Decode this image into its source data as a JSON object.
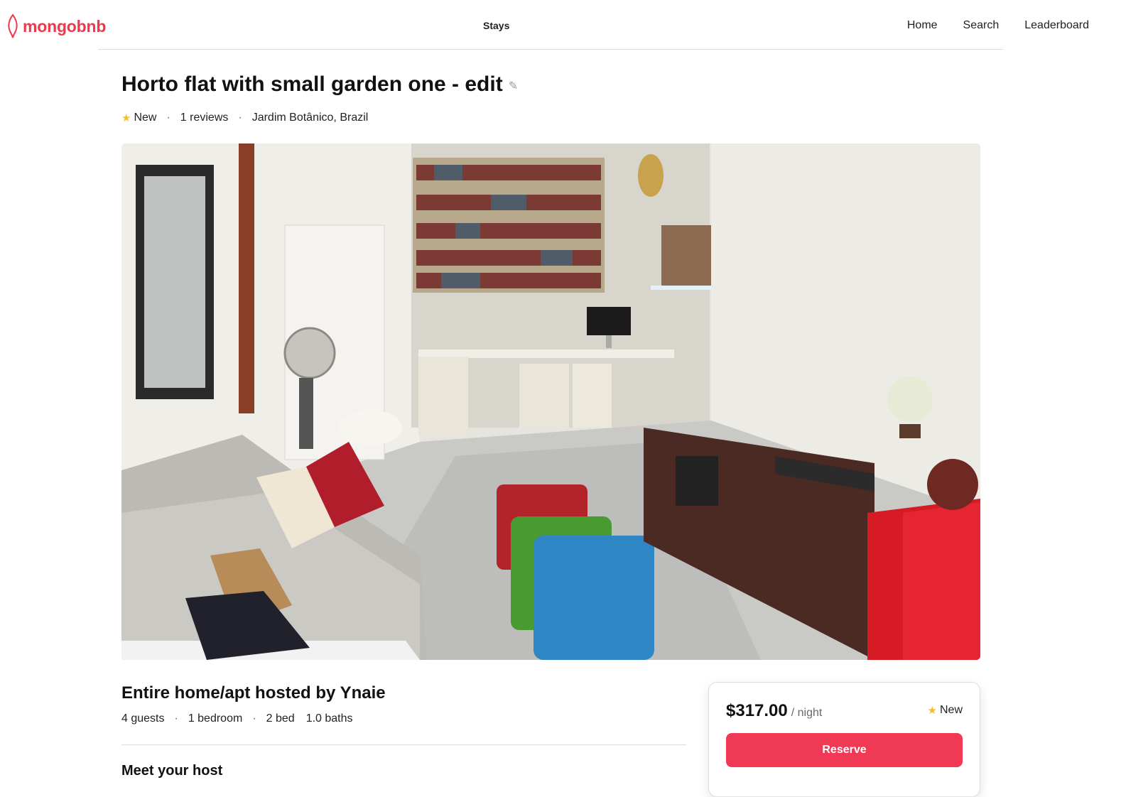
{
  "brand": {
    "name": "mongobnb",
    "color": "#f0384c"
  },
  "header": {
    "center_label": "Stays",
    "nav": [
      "Home",
      "Search",
      "Leaderboard"
    ]
  },
  "listing": {
    "title": "Horto flat with small garden one - edit",
    "rating_label": "New",
    "reviews": "1 reviews",
    "location": "Jardim Botânico, Brazil",
    "host_title": "Entire home/apt hosted by Ynaie",
    "features": {
      "guests": "4 guests",
      "bedrooms": "1 bedroom",
      "beds": "2 bed",
      "baths": "1.0 baths"
    },
    "meet_host": "Meet your host"
  },
  "booking": {
    "price": "$317.00",
    "per": "/ night",
    "rating_label": "New",
    "reserve_label": "Reserve",
    "accent": "#f03a55"
  },
  "icons": {
    "rating": "star-icon",
    "edit": "pencil-icon",
    "logo": "leaf-icon"
  }
}
